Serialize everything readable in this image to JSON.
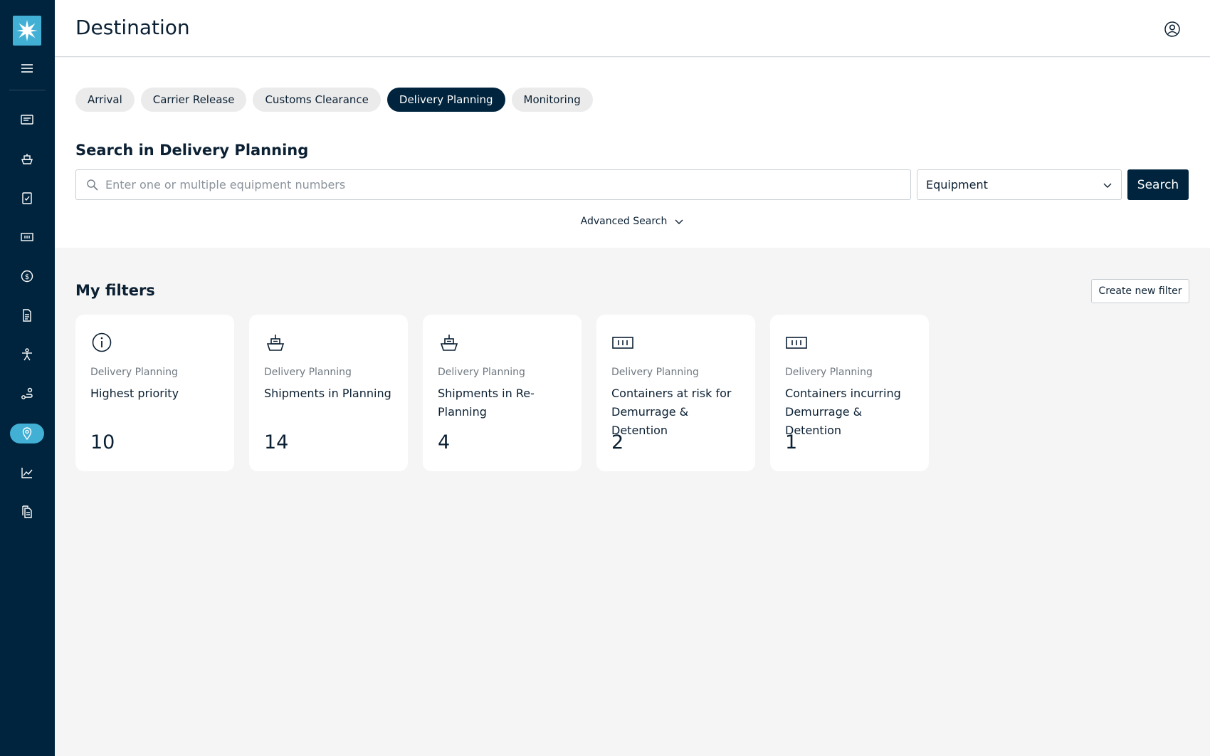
{
  "app": {
    "title": "Destination"
  },
  "sidebar": {
    "items": [
      {
        "icon": "card-list-icon",
        "name": "sidebar-item-bookings"
      },
      {
        "icon": "vessel-icon",
        "name": "sidebar-item-shipments"
      },
      {
        "icon": "clipboard-check-icon",
        "name": "sidebar-item-tasks"
      },
      {
        "icon": "container-icon",
        "name": "sidebar-item-containers"
      },
      {
        "icon": "dollar-icon",
        "name": "sidebar-item-finance"
      },
      {
        "icon": "document-icon",
        "name": "sidebar-item-documents"
      },
      {
        "icon": "person-icon",
        "name": "sidebar-item-people"
      },
      {
        "icon": "route-icon",
        "name": "sidebar-item-routes"
      },
      {
        "icon": "location-pin-icon",
        "name": "sidebar-item-destination",
        "active": true
      },
      {
        "icon": "chart-line-icon",
        "name": "sidebar-item-analytics"
      },
      {
        "icon": "files-icon",
        "name": "sidebar-item-reports"
      }
    ]
  },
  "tabs": [
    {
      "label": "Arrival",
      "active": false
    },
    {
      "label": "Carrier Release",
      "active": false
    },
    {
      "label": "Customs Clearance",
      "active": false
    },
    {
      "label": "Delivery Planning",
      "active": true
    },
    {
      "label": "Monitoring",
      "active": false
    }
  ],
  "search": {
    "heading": "Search in Delivery Planning",
    "placeholder": "Enter one or multiple equipment numbers",
    "value": "",
    "type_selected": "Equipment",
    "button_label": "Search",
    "advanced_label": "Advanced Search"
  },
  "filters": {
    "title": "My filters",
    "create_label": "Create new filter",
    "cards": [
      {
        "icon": "info-icon",
        "category": "Delivery Planning",
        "name": "Highest priority",
        "count": "10"
      },
      {
        "icon": "vessel-icon",
        "category": "Delivery Planning",
        "name": "Shipments in Planning",
        "count": "14"
      },
      {
        "icon": "vessel-icon",
        "category": "Delivery Planning",
        "name": "Shipments in Re-Planning",
        "count": "4"
      },
      {
        "icon": "container-icon",
        "category": "Delivery Planning",
        "name": "Containers at risk for Demurrage & Detention",
        "count": "2"
      },
      {
        "icon": "container-icon",
        "category": "Delivery Planning",
        "name": "Containers incurring Demurrage & Detention",
        "count": "1"
      }
    ]
  },
  "colors": {
    "sidebar": "#00243d",
    "accent": "#42b0d5",
    "primary_button": "#00243d",
    "background": "#f5f5f5"
  }
}
